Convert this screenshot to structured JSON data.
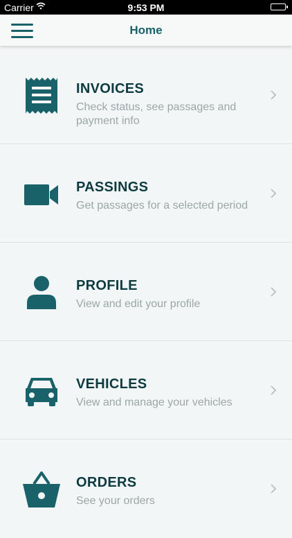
{
  "status_bar": {
    "carrier": "Carrier",
    "time": "9:53 PM",
    "battery_level": 1.0
  },
  "nav": {
    "title": "Home",
    "menu_icon": "hamburger-menu-icon"
  },
  "colors": {
    "accent": "#19626a",
    "title_text": "#0d3b40",
    "desc_text": "#9ba6a7",
    "background": "#f3f6f6"
  },
  "menu": {
    "items": [
      {
        "title": "INVOICES",
        "description": "Check status, see passages and payment info",
        "icon": "receipt-icon"
      },
      {
        "title": "PASSINGS",
        "description": "Get passages for a selected period",
        "icon": "video-camera-icon"
      },
      {
        "title": "PROFILE",
        "description": "View and edit your profile",
        "icon": "person-icon"
      },
      {
        "title": "VEHICLES",
        "description": "View and manage your vehicles",
        "icon": "car-icon"
      },
      {
        "title": "ORDERS",
        "description": "See your orders",
        "icon": "basket-icon"
      }
    ]
  }
}
